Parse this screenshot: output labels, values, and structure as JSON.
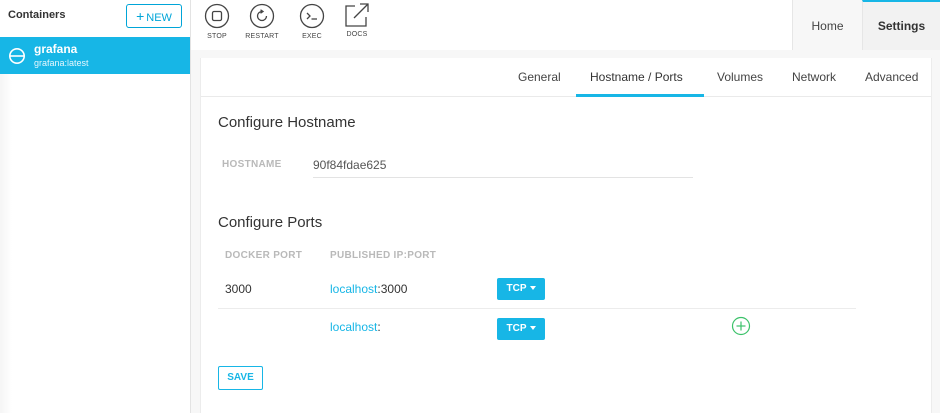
{
  "sidebar": {
    "title": "Containers",
    "new_button": "NEW",
    "containers": [
      {
        "name": "grafana",
        "image": "grafana:latest"
      }
    ]
  },
  "toolbar": {
    "stop": "STOP",
    "restart": "RESTART",
    "exec": "EXEC",
    "docs": "DOCS"
  },
  "top_tabs": {
    "home": "Home",
    "settings": "Settings",
    "active": "Settings"
  },
  "subtabs": {
    "items": [
      "General",
      "Hostname / Ports",
      "Volumes",
      "Network",
      "Advanced"
    ],
    "active": "Hostname / Ports"
  },
  "hostname": {
    "section_title": "Configure Hostname",
    "label": "HOSTNAME",
    "value": "90f84fdae625"
  },
  "ports": {
    "section_title": "Configure Ports",
    "col_docker_port": "DOCKER PORT",
    "col_published": "PUBLISHED IP:PORT",
    "rows": [
      {
        "docker_port": "3000",
        "host": "localhost",
        "sep": ":",
        "host_port": "3000",
        "protocol": "TCP"
      },
      {
        "docker_port": "",
        "host": "localhost",
        "sep": ":",
        "host_port": "",
        "protocol": "TCP"
      }
    ]
  },
  "save_button": "SAVE",
  "colors": {
    "accent": "#17b6e6",
    "add_icon": "#3cc26a"
  }
}
